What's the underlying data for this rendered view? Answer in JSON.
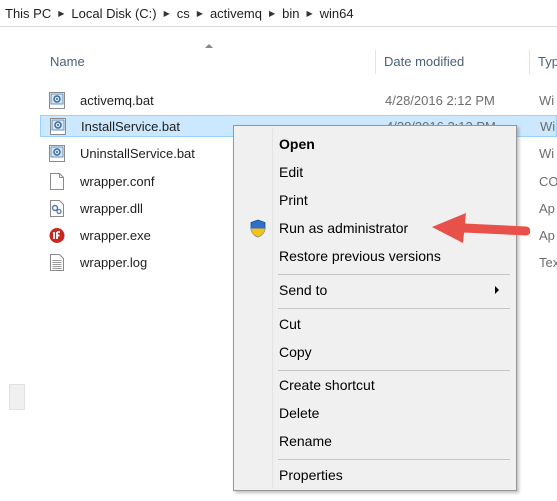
{
  "breadcrumb": {
    "items": [
      "This PC",
      "Local Disk (C:)",
      "cs",
      "activemq",
      "bin",
      "win64"
    ]
  },
  "columns": {
    "name": "Name",
    "date": "Date modified",
    "type": "Typ"
  },
  "files": [
    {
      "name": "activemq.bat",
      "date": "4/28/2016 2:12 PM",
      "type": "Wi",
      "icon": "batch-file-icon",
      "selected": false
    },
    {
      "name": "InstallService.bat",
      "date": "4/28/2016 2:12 PM",
      "type": "Wi",
      "icon": "batch-file-icon",
      "selected": true
    },
    {
      "name": "UninstallService.bat",
      "date": "",
      "type": "Wi",
      "icon": "batch-file-icon",
      "selected": false
    },
    {
      "name": "wrapper.conf",
      "date": "",
      "type": "CO",
      "icon": "blank-file-icon",
      "selected": false
    },
    {
      "name": "wrapper.dll",
      "date": "",
      "type": "Ap",
      "icon": "dll-file-icon",
      "selected": false
    },
    {
      "name": "wrapper.exe",
      "date": "",
      "type": "Ap",
      "icon": "exe-app-icon",
      "selected": false
    },
    {
      "name": "wrapper.log",
      "date": "",
      "type": "Tex",
      "icon": "text-file-icon",
      "selected": false
    }
  ],
  "context_menu": {
    "items": [
      {
        "label": "Open",
        "bold": true
      },
      {
        "label": "Edit"
      },
      {
        "label": "Print"
      },
      {
        "label": "Run as administrator",
        "icon": "uac-shield-icon"
      },
      {
        "label": "Restore previous versions"
      },
      {
        "label": "Send to",
        "submenu": true
      },
      {
        "label": "Cut"
      },
      {
        "label": "Copy"
      },
      {
        "label": "Create shortcut"
      },
      {
        "label": "Delete"
      },
      {
        "label": "Rename"
      },
      {
        "label": "Properties"
      }
    ]
  },
  "colors": {
    "selection": "#cce8ff",
    "selection_border": "#99d1ff",
    "menu_bg": "#f0f0f0",
    "annotation_arrow": "#e8504a"
  }
}
